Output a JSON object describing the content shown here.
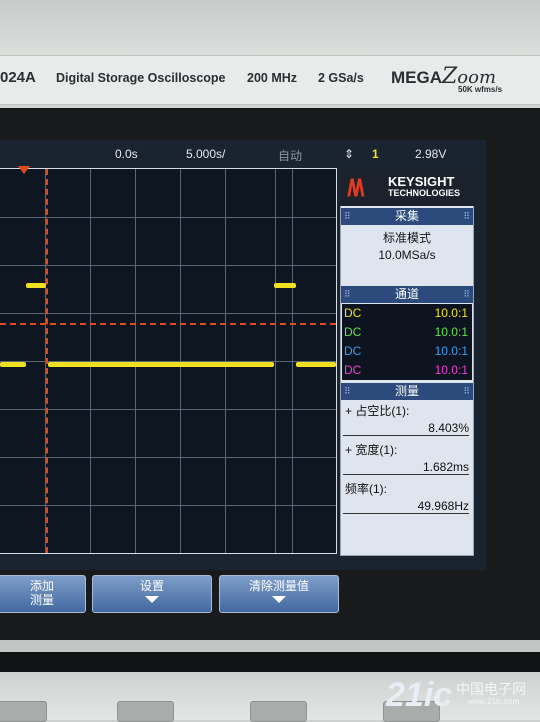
{
  "instrument": {
    "model": "024A",
    "description": "Digital Storage Oscilloscope",
    "bandwidth": "200 MHz",
    "sample_rate": "2 GSa/s",
    "brand_left": "MEGA",
    "brand_right": "oom",
    "brand_sub": "50K wfms/s"
  },
  "status_bar": {
    "delay": "0.0s",
    "timebase": "5.000s/",
    "mode": "自动",
    "trigger_channel": "1",
    "trigger_level": "2.98V"
  },
  "logo": {
    "line1": "KEYSIGHT",
    "line2": "TECHNOLOGIES"
  },
  "acquire": {
    "title": "采集",
    "mode": "标准模式",
    "rate": "10.0MSa/s"
  },
  "channels": {
    "title": "通道",
    "rows": [
      {
        "coupling": "DC",
        "probe": "10.0:1",
        "color": "#f3e21d"
      },
      {
        "coupling": "DC",
        "probe": "10.0:1",
        "color": "#5fe24a"
      },
      {
        "coupling": "DC",
        "probe": "10.0:1",
        "color": "#3aa0f2"
      },
      {
        "coupling": "DC",
        "probe": "10.0:1",
        "color": "#f03fd3"
      }
    ]
  },
  "measure": {
    "title": "测量",
    "items": [
      {
        "label": "+ 占空比(1):",
        "value": "8.403%"
      },
      {
        "label": "+ 宽度(1):",
        "value": "1.682ms"
      },
      {
        "label": "频率(1):",
        "value": "49.968Hz"
      }
    ]
  },
  "softkeys": [
    {
      "label": "添加\n测量"
    },
    {
      "label": "设置"
    },
    {
      "label": "清除测量值"
    }
  ],
  "watermark": {
    "main": "21ic",
    "cn": "中国电子网",
    "url": "www.21ic.com"
  },
  "colors": {
    "trace": "#f0e022",
    "trigger_marker": "#e24a1e",
    "panel_header": "#2c4b7c"
  }
}
